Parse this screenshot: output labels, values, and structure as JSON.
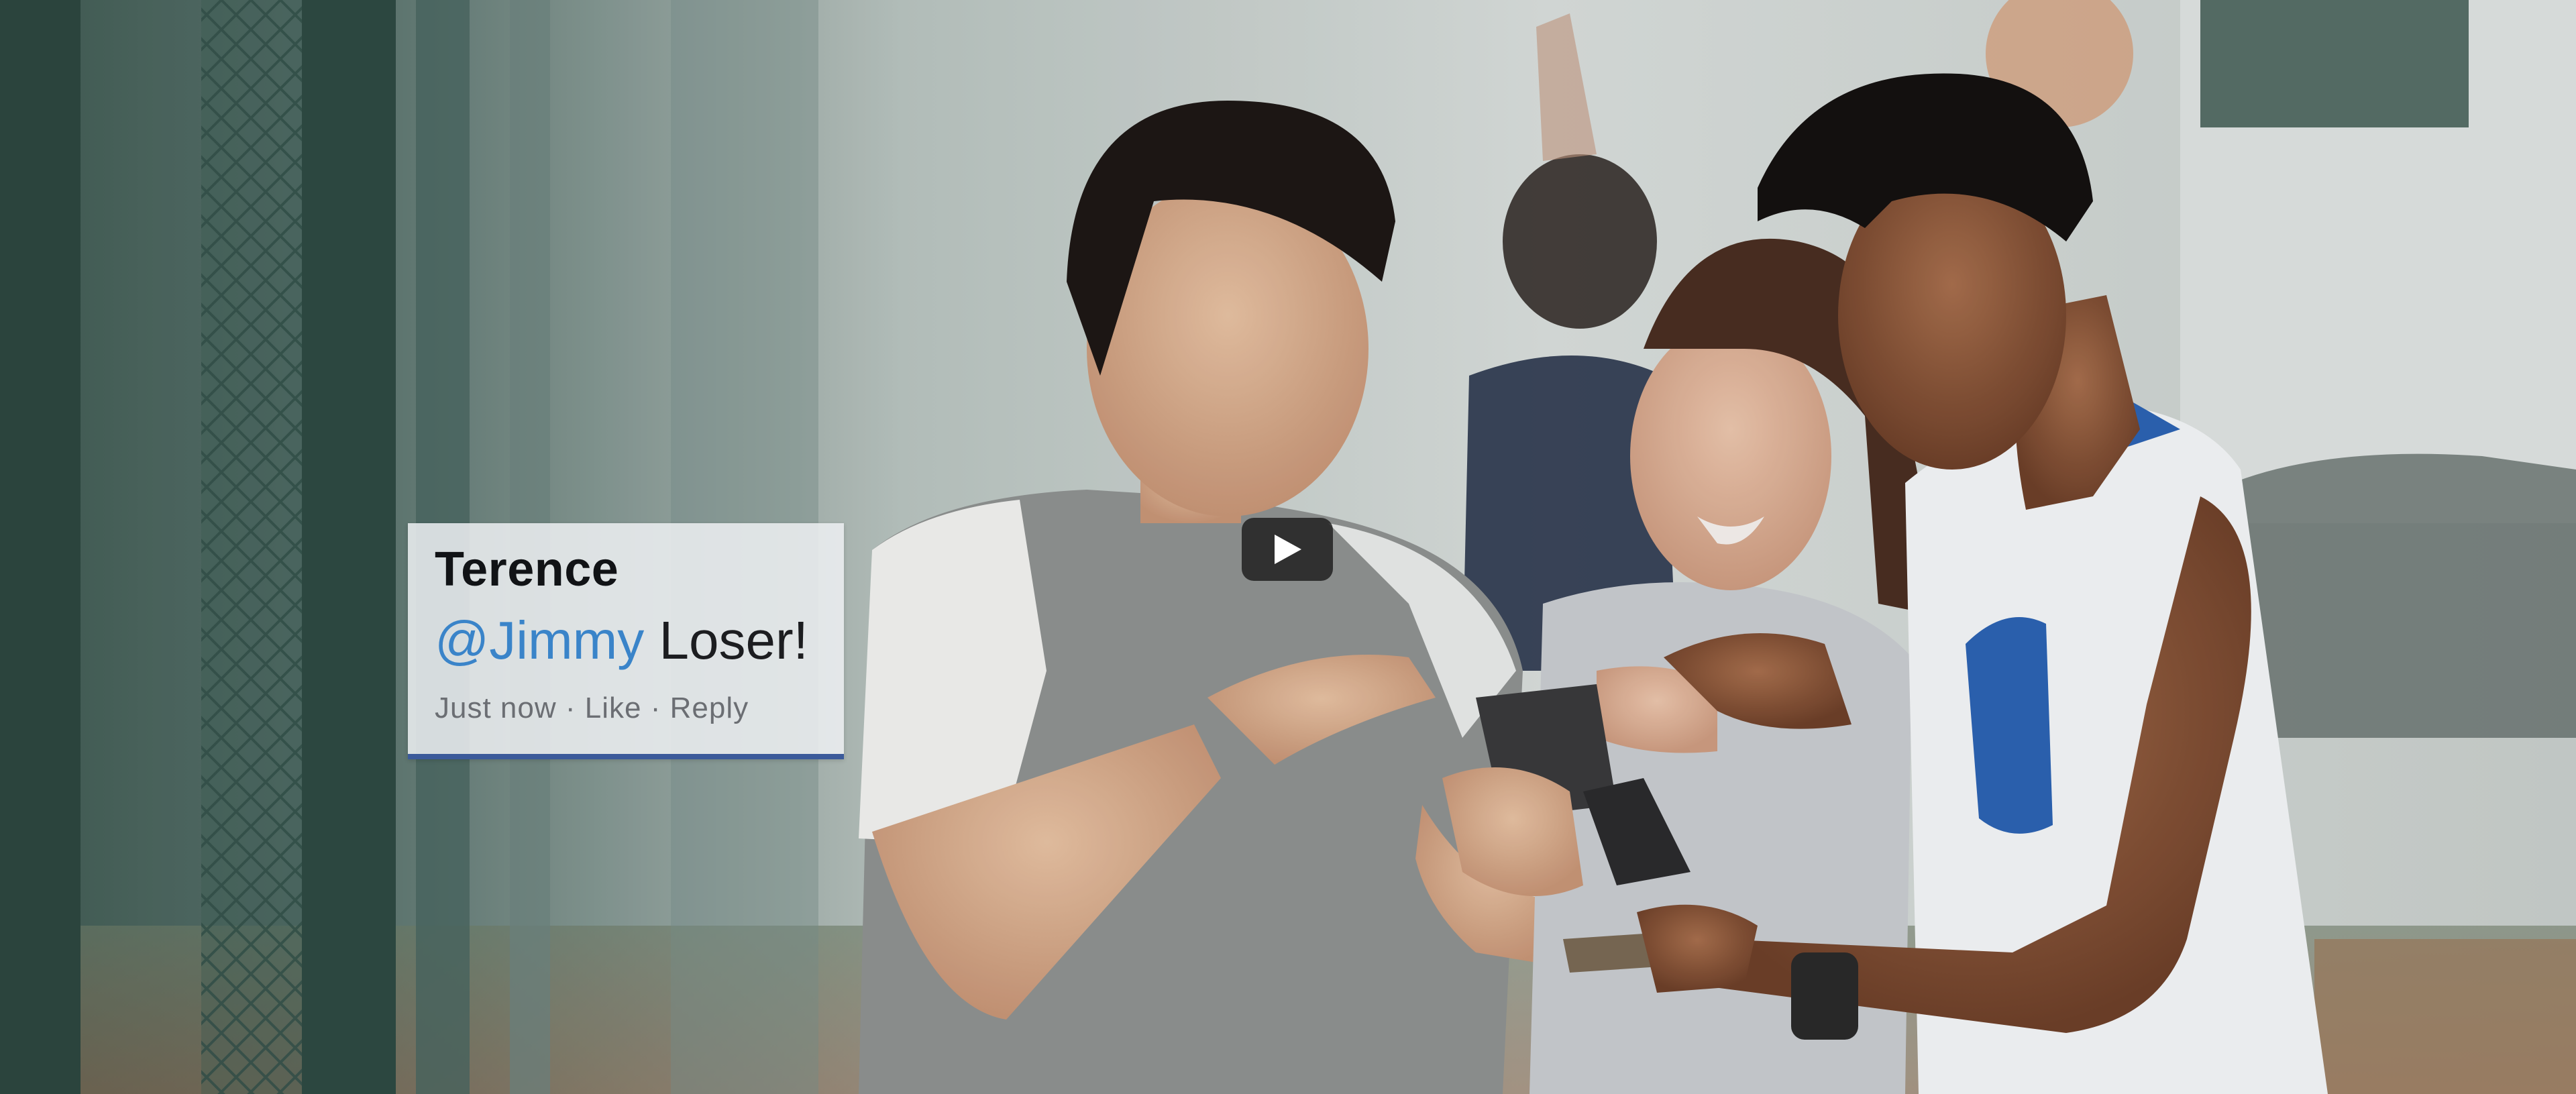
{
  "video": {
    "comment": {
      "author": "Terence",
      "mention": "@Jimmy",
      "text": "Loser!",
      "timestamp": "Just now",
      "separator": "·",
      "like_label": "Like",
      "reply_label": "Reply"
    },
    "controls": {
      "play_icon": "play-icon"
    },
    "colors": {
      "mention": "#3a84c9",
      "card_accent": "#3b5a9a",
      "play_button_bg": "#1c1c1c"
    }
  }
}
